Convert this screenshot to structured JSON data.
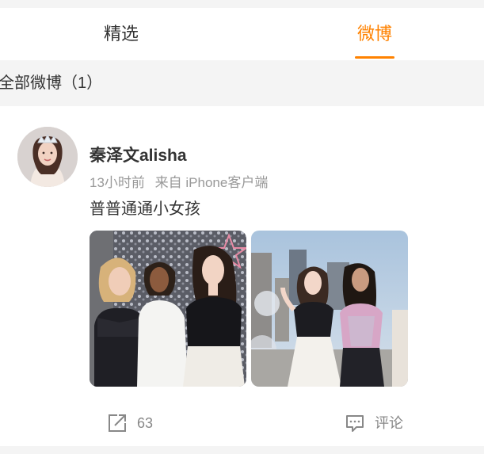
{
  "tabs": [
    {
      "label": "精选",
      "active": false
    },
    {
      "label": "微博",
      "active": true
    }
  ],
  "accent_color": "#ff8200",
  "filter": {
    "label": "全部微博（1）"
  },
  "post": {
    "author": "秦泽文alisha",
    "time": "13小时前",
    "source": "来自 iPhone客户端",
    "text": "普普通通小女孩",
    "images": [
      {
        "alt": "三位女孩合影"
      },
      {
        "alt": "两位女孩户外合影"
      }
    ],
    "actions": {
      "repost": {
        "icon": "share-icon",
        "count": "63"
      },
      "comment": {
        "icon": "comment-icon",
        "label": "评论"
      }
    }
  }
}
